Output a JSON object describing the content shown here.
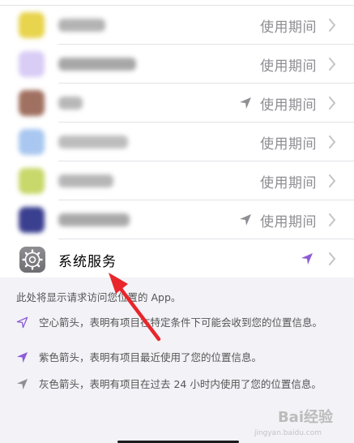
{
  "apps": [
    {
      "value": "使用期间",
      "has_location_icon": false,
      "icon_color": "#e8d44d",
      "blur_color": "#9a9a9a"
    },
    {
      "value": "使用期间",
      "has_location_icon": false,
      "icon_color": "#d9ccf5",
      "blur_color": "#8a8a8a"
    },
    {
      "value": "使用期间",
      "has_location_icon": true,
      "icon_color": "#a07060",
      "blur_color": "#a0a0a0"
    },
    {
      "value": "使用期间",
      "has_location_icon": false,
      "icon_color": "#a9c7f0",
      "blur_color": "#a6a6a6"
    },
    {
      "value": "使用期间",
      "has_location_icon": false,
      "icon_color": "#c8d86a",
      "blur_color": "#9e9e9e"
    },
    {
      "value": "使用期间",
      "has_location_icon": true,
      "icon_color": "#3a3f8f",
      "blur_color": "#8c8c8c"
    }
  ],
  "system_services": {
    "label": "系统服务",
    "icon": "gear-icon",
    "location_color": "#8e5bd6"
  },
  "footer": {
    "intro": "此处将显示请求访问您位置的 App。",
    "legend": [
      {
        "icon": "hollow-arrow-icon",
        "text": "空心箭头，表明有项目在特定条件下可能会收到您的位置信息。"
      },
      {
        "icon": "purple-arrow-icon",
        "text": "紫色箭头，表明有项目最近使用了您的位置信息。"
      },
      {
        "icon": "gray-arrow-icon",
        "text": "灰色箭头，表明有项目在过去 24 小时内使用了您的位置信息。"
      }
    ]
  },
  "watermark": {
    "text": "Bai经验",
    "sub": "jingyan.baidu.com"
  },
  "colors": {
    "accent_purple": "#8e5bd6",
    "annotation_red": "#e8262b",
    "chevron": "#c4c4c7"
  }
}
